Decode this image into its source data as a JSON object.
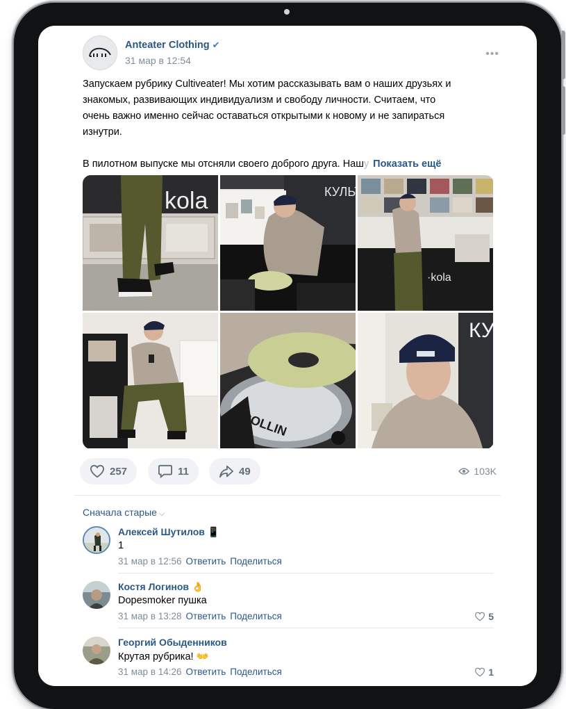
{
  "post": {
    "author": "Anteater Clothing",
    "date": "31 мар в 12:54",
    "text_lines": [
      "Запускаем рубрику Cultiveater! Мы хотим рассказывать вам о наших друзьях и",
      "знакомых, развивающих индивидуализм и свободу личности. Считаем, что",
      "очень важно именно сейчас оставаться открытыми к новому и не запираться",
      "изнутри."
    ],
    "text_second": "В пилотном выпуске мы отсняли своего доброго друга. Наш",
    "text_faded": "у",
    "show_more": "Показать ещё",
    "photo_labels": {
      "kola": "kola",
      "kult": "КУЛЬТ",
      "kola_small": "·kola",
      "rollin": "ROLLIN",
      "ku": "КУ"
    }
  },
  "actions": {
    "likes": "257",
    "comments": "11",
    "shares": "49",
    "views": "103K"
  },
  "comments_sort": "Сначала старые",
  "comments": [
    {
      "name": "Алексей Шутилов",
      "emoji": "📱",
      "text": "1",
      "date": "31 мар в 12:56",
      "reply": "Ответить",
      "share": "Поделиться",
      "likes": ""
    },
    {
      "name": "Костя Логинов",
      "emoji": "👌",
      "text": "Dopesmoker пушка",
      "date": "31 мар в 13:28",
      "reply": "Ответить",
      "share": "Поделиться",
      "likes": "5"
    },
    {
      "name": "Георгий Обыденников",
      "emoji": "",
      "text": "Крутая рубрика! 👐",
      "date": "31 мар в 14:26",
      "reply": "Ответить",
      "share": "Поделиться",
      "likes": "1"
    }
  ],
  "colors": {
    "link": "#2a5885",
    "secondary": "#818c99",
    "pill": "#f0f2f5"
  }
}
